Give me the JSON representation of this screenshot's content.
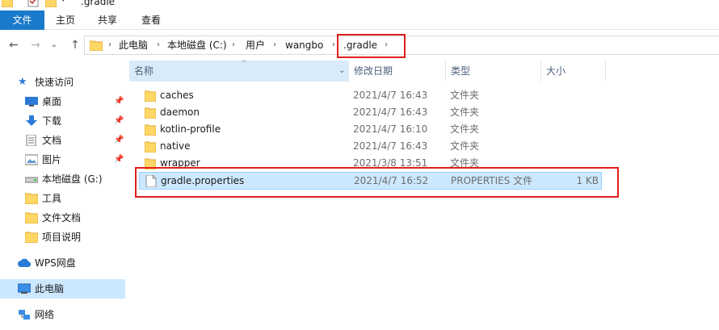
{
  "window": {
    "title": ".gradle"
  },
  "ribbon": {
    "tabs": [
      {
        "label": "文件",
        "active": true
      },
      {
        "label": "主页"
      },
      {
        "label": "共享"
      },
      {
        "label": "查看"
      }
    ]
  },
  "address": {
    "crumbs": [
      "此电脑",
      "本地磁盘 (C:)",
      "用户",
      "wangbo",
      ".gradle"
    ],
    "highlight_color": "#e0201c"
  },
  "sidebar": {
    "quick_access": "快速访问",
    "items": [
      {
        "label": "桌面",
        "icon": "desktop-icon",
        "pinned": true
      },
      {
        "label": "下载",
        "icon": "download-icon",
        "pinned": true
      },
      {
        "label": "文档",
        "icon": "document-icon",
        "pinned": true
      },
      {
        "label": "图片",
        "icon": "picture-icon",
        "pinned": true
      },
      {
        "label": "本地磁盘 (G:)",
        "icon": "drive-icon"
      },
      {
        "label": "工具",
        "icon": "folder-icon"
      },
      {
        "label": "文件文档",
        "icon": "folder-icon"
      },
      {
        "label": "项目说明",
        "icon": "folder-icon"
      }
    ],
    "wps": "WPS网盘",
    "this_pc": "此电脑",
    "network": "网络"
  },
  "columns": {
    "name": "名称",
    "date": "修改日期",
    "type": "类型",
    "size": "大小"
  },
  "files": [
    {
      "name": "caches",
      "date": "2021/4/7 16:43",
      "type": "文件夹",
      "size": "",
      "kind": "folder"
    },
    {
      "name": "daemon",
      "date": "2021/4/7 16:43",
      "type": "文件夹",
      "size": "",
      "kind": "folder"
    },
    {
      "name": "kotlin-profile",
      "date": "2021/4/7 16:10",
      "type": "文件夹",
      "size": "",
      "kind": "folder"
    },
    {
      "name": "native",
      "date": "2021/4/7 16:43",
      "type": "文件夹",
      "size": "",
      "kind": "folder"
    },
    {
      "name": "wrapper",
      "date": "2021/3/8 13:51",
      "type": "文件夹",
      "size": "",
      "kind": "folder"
    },
    {
      "name": "gradle.properties",
      "date": "2021/4/7 16:52",
      "type": "PROPERTIES 文件",
      "size": "1 KB",
      "kind": "file"
    }
  ],
  "colors": {
    "accent": "#1979ca",
    "selection": "#cce8ff",
    "folder": "#ffd766"
  }
}
